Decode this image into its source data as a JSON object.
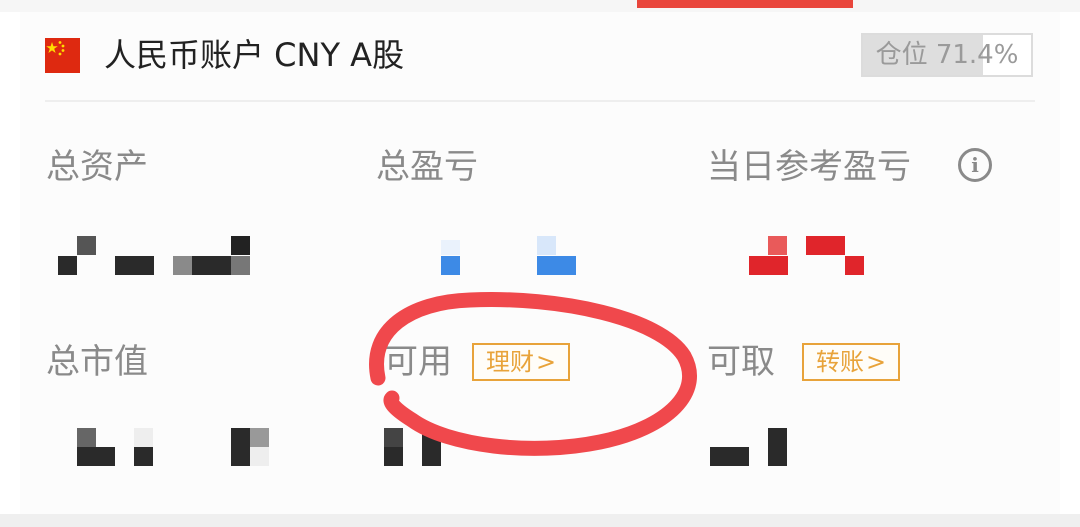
{
  "account": {
    "flag_icon": "china-flag-icon",
    "title": "人民币账户 CNY A股",
    "position_label": "仓位 71.4%",
    "position_ratio": 0.714
  },
  "stats": {
    "total_assets_label": "总资产",
    "total_pnl_label": "总盈亏",
    "daily_pnl_label": "当日参考盈亏",
    "info_icon_symbol": "i",
    "market_value_label": "总市值",
    "available_label": "可用",
    "available_link": "理财",
    "withdrawable_label": "可取",
    "withdrawable_link": "转账",
    "chevron_symbol": ">"
  },
  "colors": {
    "accent_red": "#e9463c",
    "link_orange": "#e8a33a",
    "gain_red": "#e0252b",
    "loss_blue": "#3d8ae6",
    "label_gray": "#8a8a8a",
    "annotation_red": "#f0484c"
  }
}
